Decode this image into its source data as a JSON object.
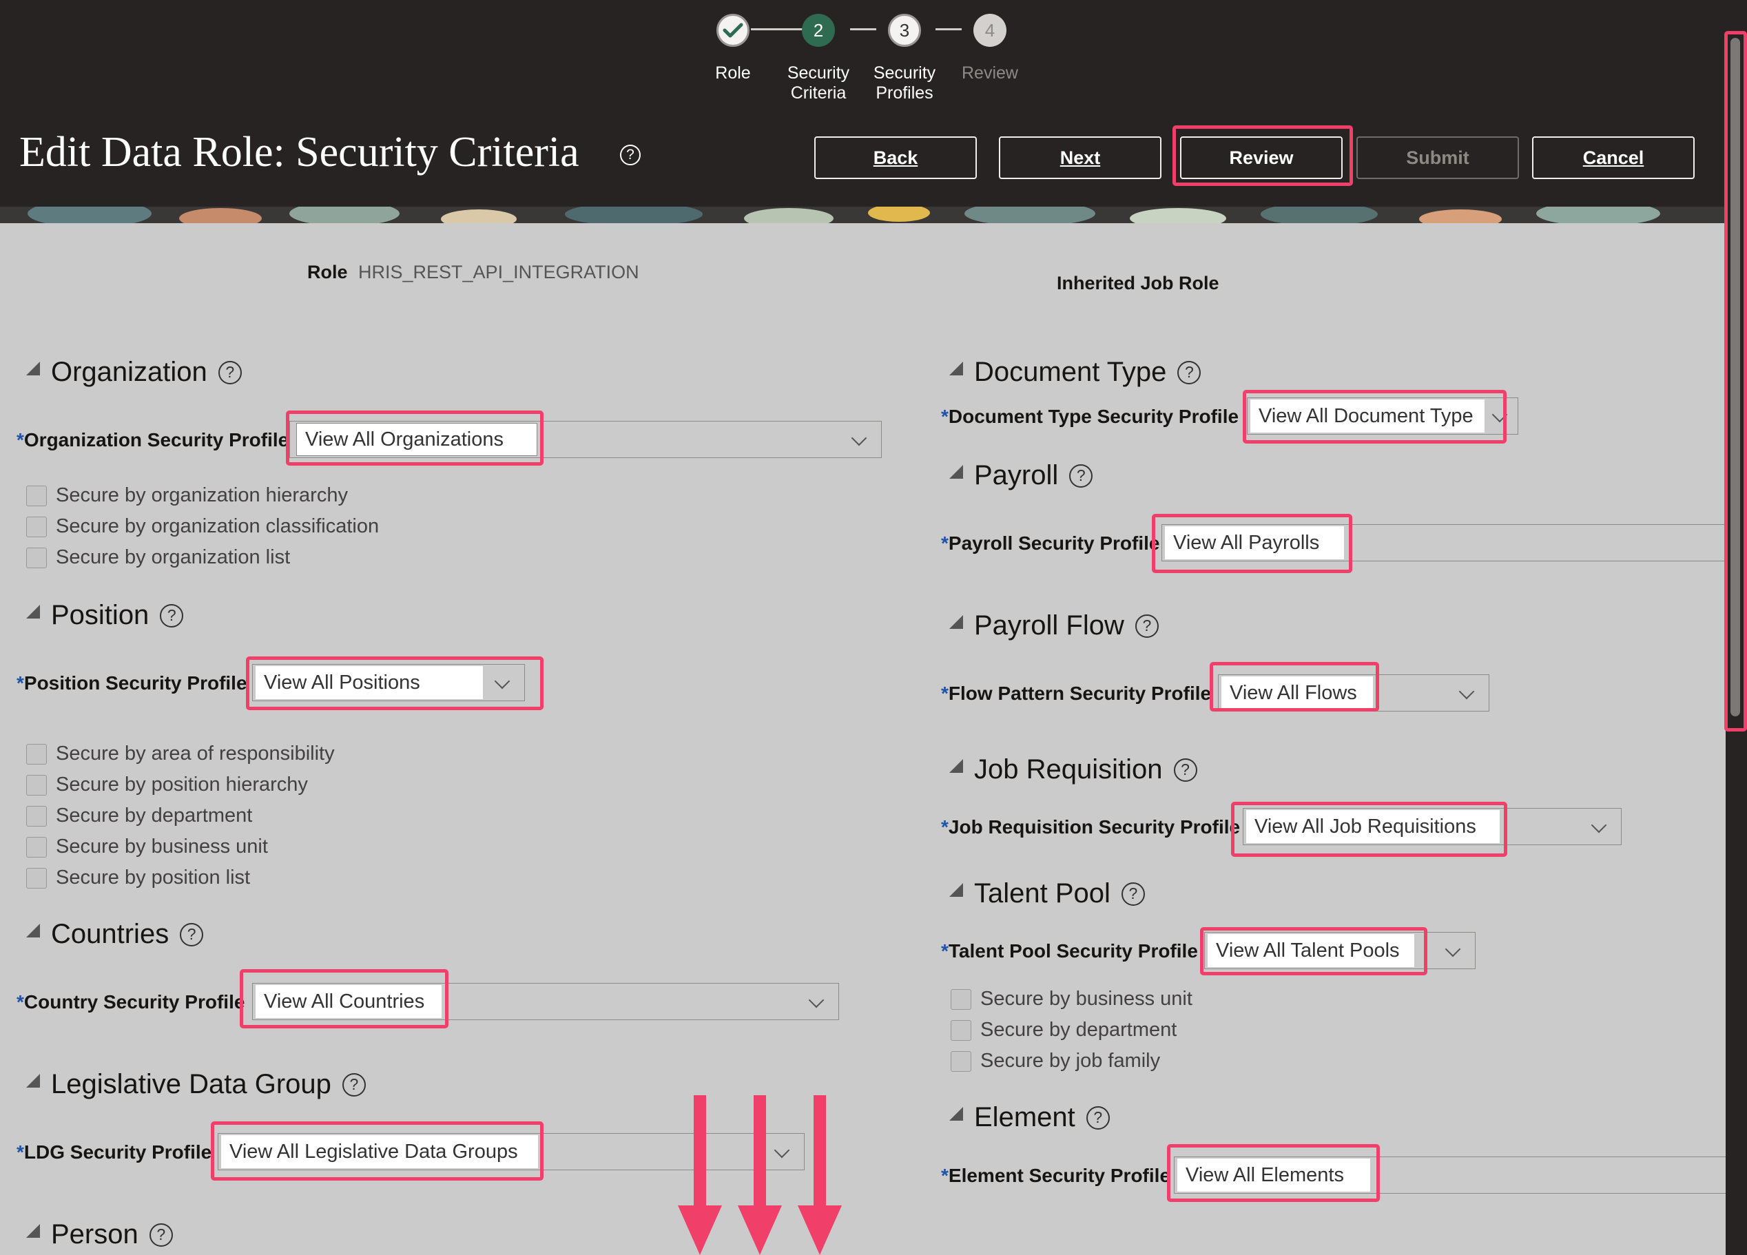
{
  "train": {
    "steps": [
      {
        "number": "",
        "label": "Role",
        "state": "complete"
      },
      {
        "number": "2",
        "label": "Security\nCriteria",
        "state": "current"
      },
      {
        "number": "3",
        "label": "Security\nProfiles",
        "state": "upcoming"
      },
      {
        "number": "4",
        "label": "Review",
        "state": "disabled"
      }
    ]
  },
  "header": {
    "title": "Edit Data Role: Security Criteria",
    "help_glyph": "?",
    "buttons": {
      "back": "Back",
      "next": "Next",
      "review": "Review",
      "submit": "Submit",
      "cancel": "Cancel"
    }
  },
  "role": {
    "label": "Role",
    "value": "HRIS_REST_API_INTEGRATION",
    "inherited_label": "Inherited Job Role"
  },
  "left": {
    "organization": {
      "title": "Organization",
      "field_label": "Organization Security Profile",
      "value": "View All Organizations",
      "checkboxes": [
        "Secure by organization hierarchy",
        "Secure by organization classification",
        "Secure by organization list"
      ]
    },
    "position": {
      "title": "Position",
      "field_label": "Position Security Profile",
      "value": "View All Positions",
      "checkboxes": [
        "Secure by area of responsibility",
        "Secure by position hierarchy",
        "Secure by department",
        "Secure by business unit",
        "Secure by position list"
      ]
    },
    "countries": {
      "title": "Countries",
      "field_label": "Country Security Profile",
      "value": "View All Countries"
    },
    "ldg": {
      "title": "Legislative Data Group",
      "field_label": "LDG Security Profile",
      "value": "View All Legislative Data Groups"
    },
    "person": {
      "title": "Person"
    }
  },
  "right": {
    "document_type": {
      "title": "Document Type",
      "field_label": "Document Type Security Profile",
      "value": "View All Document Type"
    },
    "payroll": {
      "title": "Payroll",
      "field_label": "Payroll Security Profile",
      "value": "View All Payrolls"
    },
    "payroll_flow": {
      "title": "Payroll Flow",
      "field_label": "Flow Pattern Security Profile",
      "value": "View All Flows"
    },
    "job_requisition": {
      "title": "Job Requisition",
      "field_label": "Job Requisition Security Profile",
      "value": "View All Job Requisitions"
    },
    "talent_pool": {
      "title": "Talent Pool",
      "field_label": "Talent Pool Security Profile",
      "value": "View All Talent Pools",
      "checkboxes": [
        "Secure by business unit",
        "Secure by department",
        "Secure by job family"
      ]
    },
    "element": {
      "title": "Element",
      "field_label": "Element Security Profile",
      "value": "View All Elements"
    }
  },
  "required_marker": "*",
  "colors": {
    "header_bg": "#262322",
    "content_bg": "#cbcbcb",
    "step_current": "#2e6b50",
    "annotation_red": "#f0406a"
  }
}
